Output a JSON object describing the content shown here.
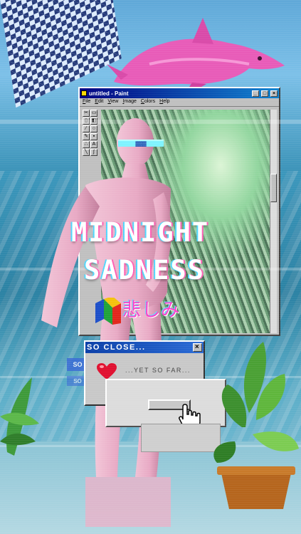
{
  "paint_window": {
    "title": "untitled - Paint",
    "menu": [
      "File",
      "Edit",
      "View",
      "Image",
      "Colors",
      "Help"
    ],
    "window_buttons": [
      "_",
      "□",
      "×"
    ]
  },
  "artwork": {
    "title_line1": "MIDNIGHT",
    "title_line2": "SADNESS",
    "japanese_text": "悲しみ"
  },
  "dialog": {
    "title": "SO CLOSE...",
    "close_glyph": "×",
    "message": "...YET SO FAR...",
    "ghost_label_1": "SO",
    "ghost_label_2": "SO"
  },
  "colors": {
    "accent_pink": "#ff3ec8",
    "title_bar_blue": "#000080",
    "dolphin_pink": "#e85bb8",
    "cyan_glow": "#7ff3ff"
  }
}
